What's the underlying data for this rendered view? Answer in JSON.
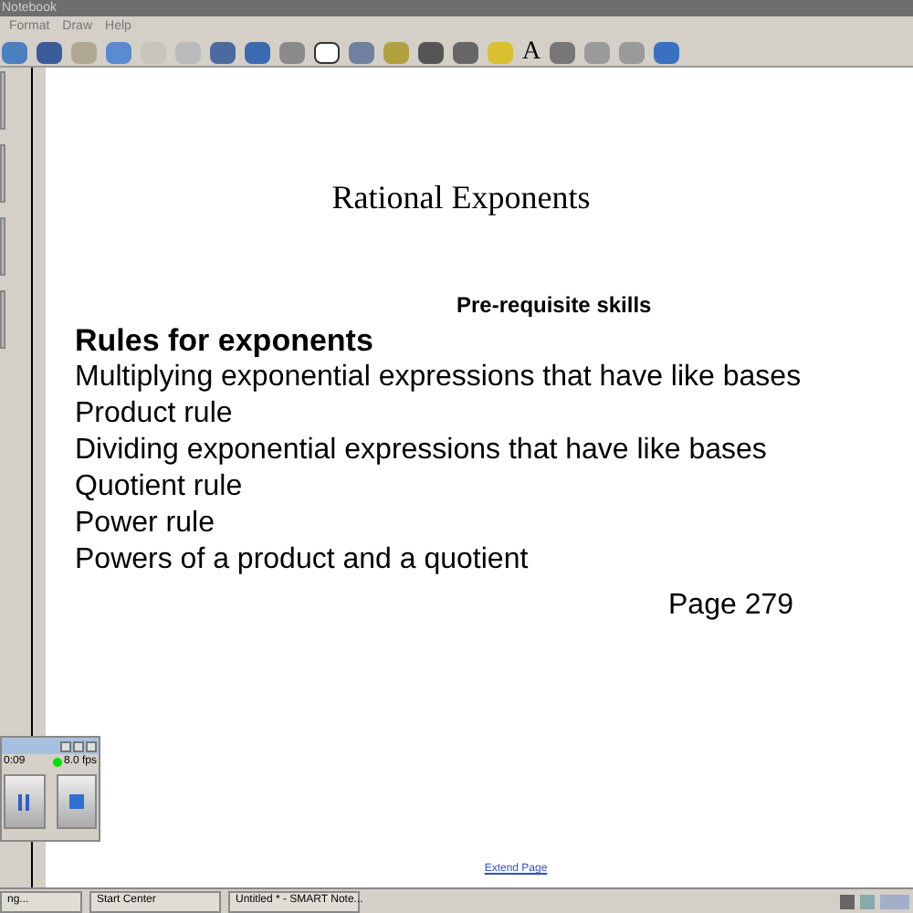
{
  "window": {
    "title": "Notebook"
  },
  "menu": [
    "Format",
    "Draw",
    "Help"
  ],
  "toolbar": {
    "text_tool": "A"
  },
  "page": {
    "title": "Rational Exponents",
    "subtitle": "Pre-requisite skills",
    "heading": "Rules for exponents",
    "lines": [
      "Multiplying exponential expressions that have like bases",
      "Product rule",
      "Dividing exponential expressions that have like bases",
      "Quotient rule",
      "Power rule",
      "Powers of a product and a quotient"
    ],
    "page_ref": "Page 279",
    "extend_link": "Extend Page"
  },
  "recorder": {
    "time": "0:09",
    "fps": "8.0 fps",
    "recording": true
  },
  "taskbar": [
    "ng...",
    "Start Center",
    "Untitled * - SMART Note..."
  ]
}
